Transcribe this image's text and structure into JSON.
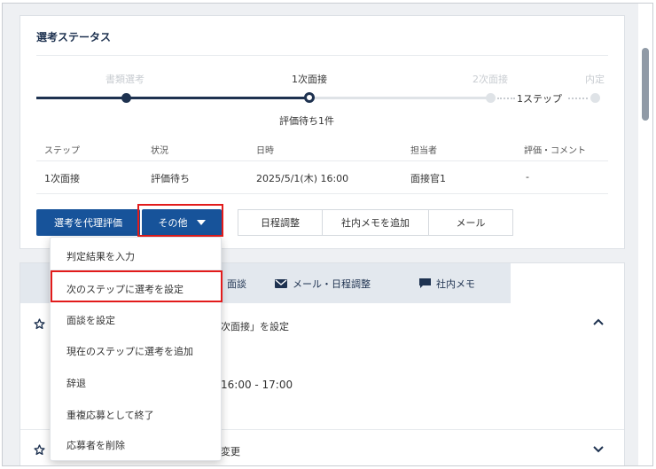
{
  "status_card": {
    "title": "選考ステータス",
    "steps": [
      "書類選考",
      "1次面接",
      "2次面接",
      "内定"
    ],
    "skip_label": "1ステップ",
    "pending_label": "評価待ち1件",
    "table": {
      "headers": [
        "ステップ",
        "状況",
        "日時",
        "担当者",
        "評価・コメント"
      ],
      "row": [
        "1次面接",
        "評価待ち",
        "2025/5/1(木) 16:00",
        "面接官1",
        "-"
      ]
    },
    "buttons": {
      "proxy_eval": "選考を代理評価",
      "other": "その他",
      "schedule": "日程調整",
      "add_memo": "社内メモを追加",
      "mail": "メール"
    }
  },
  "tabs": [
    "面談",
    "メール・日程調整",
    "社内メモ"
  ],
  "activity": {
    "item1_text": "次面接」を設定",
    "item1_time": "16:00 - 17:00",
    "item2_text": "変更"
  },
  "dropdown_menu": [
    "判定結果を入力",
    "次のステップに選考を設定",
    "面談を設定",
    "現在のステップに選考を追加",
    "辞退",
    "重複応募として終了",
    "応募者を削除"
  ],
  "colors": {
    "primary": "#17539a",
    "navy": "#1e3250",
    "highlight": "#e21b1b"
  }
}
